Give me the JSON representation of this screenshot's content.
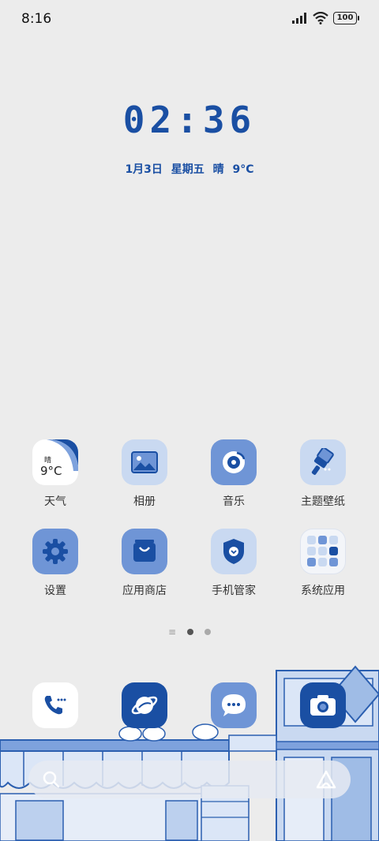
{
  "status": {
    "time": "8:16",
    "battery": "100"
  },
  "clock": {
    "time": "02:36",
    "date": "1月3日",
    "weekday": "星期五",
    "weather": "晴",
    "temp": "9°C"
  },
  "apps": [
    {
      "label": "天气",
      "widget_weather": "晴",
      "widget_temp": "9°C"
    },
    {
      "label": "相册"
    },
    {
      "label": "音乐"
    },
    {
      "label": "主题壁纸"
    },
    {
      "label": "设置"
    },
    {
      "label": "应用商店"
    },
    {
      "label": "手机管家"
    },
    {
      "label": "系统应用"
    }
  ],
  "dock": [
    {
      "name": "phone"
    },
    {
      "name": "browser"
    },
    {
      "name": "messages"
    },
    {
      "name": "camera"
    }
  ],
  "colors": {
    "accent": "#1a4fa3",
    "icon_light": "#c9d9f1",
    "icon_mid": "#6f95d6"
  }
}
